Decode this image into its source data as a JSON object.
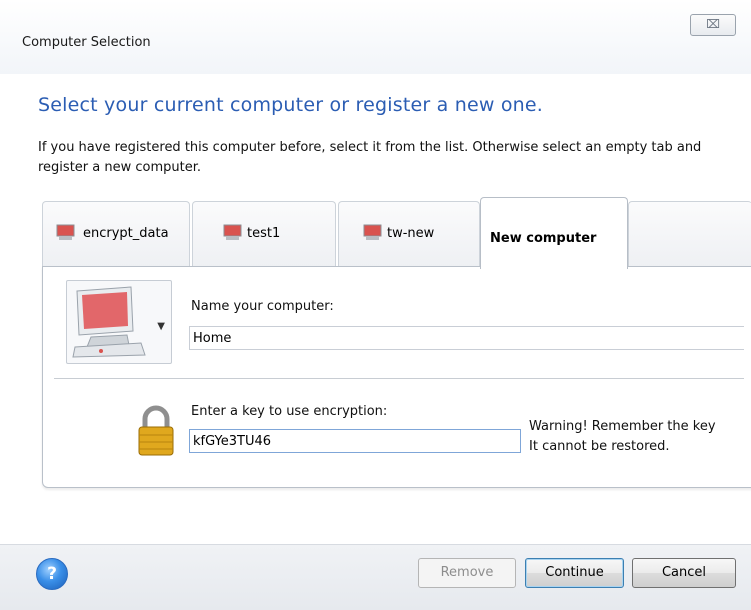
{
  "window": {
    "title": "Computer Selection",
    "close_glyph": "⌧"
  },
  "heading": "Select your current computer or register a new one.",
  "description": "If you have registered this computer before, select it from the list. Otherwise select an empty tab and register a new computer.",
  "tabs": [
    {
      "label": "encrypt_data",
      "icon": "monitor-icon"
    },
    {
      "label": "test1",
      "icon": "monitor-icon"
    },
    {
      "label": "tw-new",
      "icon": "monitor-icon"
    },
    {
      "label": "New computer",
      "active": true
    }
  ],
  "form": {
    "computer_icon": "computer-icon",
    "name_label": "Name your computer:",
    "name_value": "Home",
    "key_label": "Enter a key to use encryption:",
    "key_value": "kfGYe3TU46",
    "lock_icon": "padlock-icon",
    "warning_line1": "Warning! Remember the key",
    "warning_line2": "It cannot be restored."
  },
  "footer": {
    "help_glyph": "?",
    "remove_label": "Remove",
    "continue_label": "Continue",
    "cancel_label": "Cancel"
  }
}
